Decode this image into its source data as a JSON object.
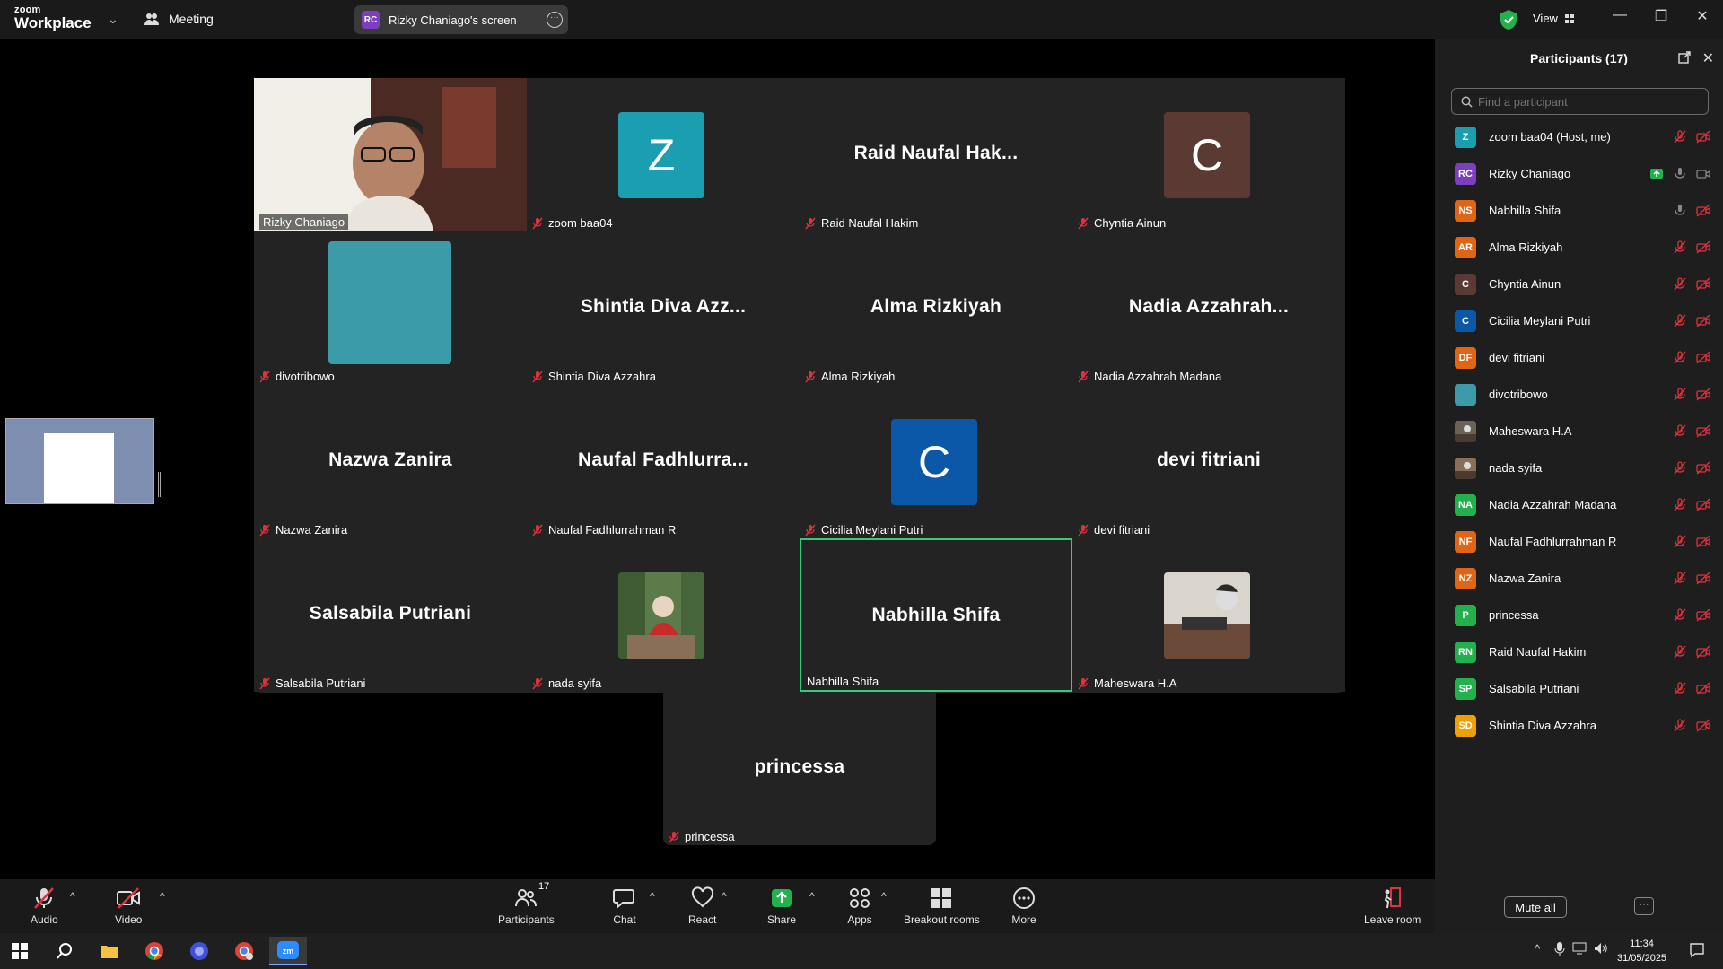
{
  "topbar": {
    "logo_line1": "zoom",
    "logo_line2": "Workplace",
    "meeting_label": "Meeting",
    "screen_badge": "RC",
    "screen_label": "Rizky Chaniago's screen",
    "view_label": "View"
  },
  "tiles": [
    {
      "kind": "video",
      "name": "Rizky Chaniago",
      "muted": false
    },
    {
      "kind": "letter",
      "letter": "Z",
      "color": "#1a9fb0",
      "name": "zoom baa04",
      "muted": true
    },
    {
      "kind": "text",
      "big": "Raid  Naufal  Hak...",
      "name": "Raid Naufal Hakim",
      "muted": true
    },
    {
      "kind": "letter",
      "letter": "C",
      "color": "#5b3a33",
      "name": "Chyntia Ainun",
      "muted": true
    },
    {
      "kind": "square",
      "color": "#3b9ba8",
      "name": "divotribowo",
      "muted": true
    },
    {
      "kind": "text",
      "big": "Shintia  Diva  Azz...",
      "name": "Shintia Diva Azzahra",
      "muted": true
    },
    {
      "kind": "text",
      "big": "Alma  Rizkiyah",
      "name": "Alma Rizkiyah",
      "muted": true
    },
    {
      "kind": "text",
      "big": "Nadia  Azzahrah...",
      "name": "Nadia Azzahrah Madana",
      "muted": true
    },
    {
      "kind": "text",
      "big": "Nazwa  Zanira",
      "name": "Nazwa Zanira",
      "muted": true
    },
    {
      "kind": "text",
      "big": "Naufal  Fadhlurra...",
      "name": "Naufal Fadhlurrahman R",
      "muted": true
    },
    {
      "kind": "letter",
      "letter": "C",
      "color": "#0b58a8",
      "name": "Cicilia Meylani Putri",
      "muted": true
    },
    {
      "kind": "text",
      "big": "devi  fitriani",
      "name": "devi fitriani",
      "muted": true
    },
    {
      "kind": "text",
      "big": "Salsabila  Putriani",
      "name": "Salsabila Putriani",
      "muted": true
    },
    {
      "kind": "photo",
      "photo": "nada-photo",
      "name": "nada syifa",
      "muted": true
    },
    {
      "kind": "text",
      "big": "Nabhilla  Shifa",
      "name": "Nabhilla Shifa",
      "muted": false,
      "active": true
    },
    {
      "kind": "photo",
      "photo": "maheswara-photo",
      "name": "Maheswara H.A",
      "muted": true
    },
    {
      "kind": "text",
      "big": "princessa",
      "name": "princessa",
      "muted": true
    }
  ],
  "toolbar": {
    "audio": "Audio",
    "video": "Video",
    "participants": "Participants",
    "participants_count": "17",
    "chat": "Chat",
    "react": "React",
    "share": "Share",
    "apps": "Apps",
    "breakout": "Breakout rooms",
    "more": "More",
    "leave": "Leave room"
  },
  "panel": {
    "title": "Participants (17)",
    "search_placeholder": "Find a participant",
    "mute_all": "Mute all",
    "participants": [
      {
        "initials": "Z",
        "color": "#1a9fb0",
        "name": "zoom baa04 (Host, me)",
        "audio": "muted",
        "video": "off"
      },
      {
        "initials": "RC",
        "color": "#7b3fbf",
        "name": "Rizky Chaniago",
        "audio": "on",
        "video": "on",
        "sharing": true
      },
      {
        "initials": "NS",
        "color": "#e06515",
        "name": "Nabhilla Shifa",
        "audio": "on",
        "video": "off"
      },
      {
        "initials": "AR",
        "color": "#e06515",
        "name": "Alma Rizkiyah",
        "audio": "muted",
        "video": "off"
      },
      {
        "initials": "C",
        "color": "#5b3a33",
        "name": "Chyntia Ainun",
        "audio": "muted",
        "video": "off"
      },
      {
        "initials": "C",
        "color": "#0b58a8",
        "name": "Cicilia Meylani Putri",
        "audio": "muted",
        "video": "off"
      },
      {
        "initials": "DF",
        "color": "#e06515",
        "name": "devi fitriani",
        "audio": "muted",
        "video": "off"
      },
      {
        "initials": "",
        "color": "#3b9ba8",
        "name": "divotribowo",
        "audio": "muted",
        "video": "off"
      },
      {
        "initials": "",
        "color": "#6b6256",
        "name": "Maheswara H.A",
        "audio": "muted",
        "video": "off",
        "photo": true
      },
      {
        "initials": "",
        "color": "#8a6f58",
        "name": "nada syifa",
        "audio": "muted",
        "video": "off",
        "photo": true
      },
      {
        "initials": "NA",
        "color": "#22b14c",
        "name": "Nadia Azzahrah Madana",
        "audio": "muted",
        "video": "off"
      },
      {
        "initials": "NF",
        "color": "#e06515",
        "name": "Naufal Fadhlurrahman R",
        "audio": "muted",
        "video": "off"
      },
      {
        "initials": "NZ",
        "color": "#e06515",
        "name": "Nazwa Zanira",
        "audio": "muted",
        "video": "off"
      },
      {
        "initials": "P",
        "color": "#22b14c",
        "name": "princessa",
        "audio": "muted",
        "video": "off"
      },
      {
        "initials": "RN",
        "color": "#22b14c",
        "name": "Raid Naufal Hakim",
        "audio": "muted",
        "video": "off"
      },
      {
        "initials": "SP",
        "color": "#22b14c",
        "name": "Salsabila Putriani",
        "audio": "muted",
        "video": "off"
      },
      {
        "initials": "SD",
        "color": "#f0a000",
        "name": "Shintia Diva Azzahra",
        "audio": "muted",
        "video": "off"
      }
    ]
  },
  "taskbar": {
    "time": "11:34",
    "date": "31/05/2025",
    "apps": [
      "windows-start",
      "search",
      "file-explorer",
      "chrome",
      "firefox-like",
      "chrome-profile",
      "zoom"
    ]
  }
}
